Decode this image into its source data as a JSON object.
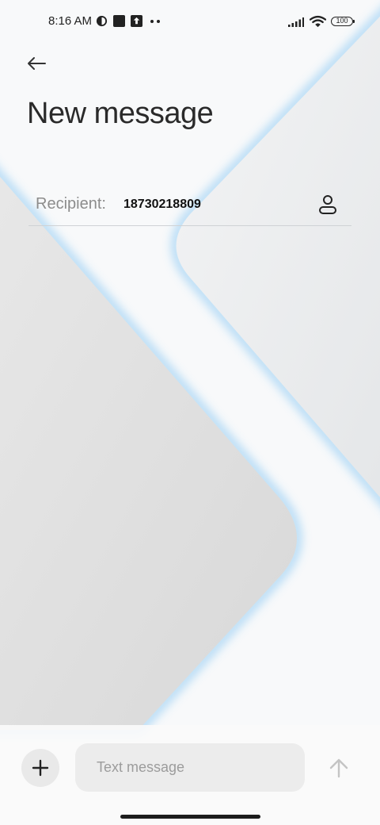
{
  "status_bar": {
    "time": "8:16 AM",
    "battery_level": "100",
    "left_icons": [
      "vpn-icon",
      "square-icon",
      "upload-icon",
      "more-dots-icon"
    ],
    "right_icons": [
      "signal-icon",
      "wifi-icon",
      "battery-icon"
    ]
  },
  "header": {
    "back_icon": "back-arrow-icon",
    "title": "New message"
  },
  "recipient": {
    "label": "Recipient:",
    "value": "18730218809",
    "contact_icon": "person-icon"
  },
  "composer": {
    "add_icon": "plus-icon",
    "placeholder": "Text message",
    "send_icon": "arrow-up-icon"
  },
  "colors": {
    "accent_glow": "#b7dcf6",
    "text_primary": "#2a2a2a",
    "text_secondary": "#8c8c8c"
  }
}
